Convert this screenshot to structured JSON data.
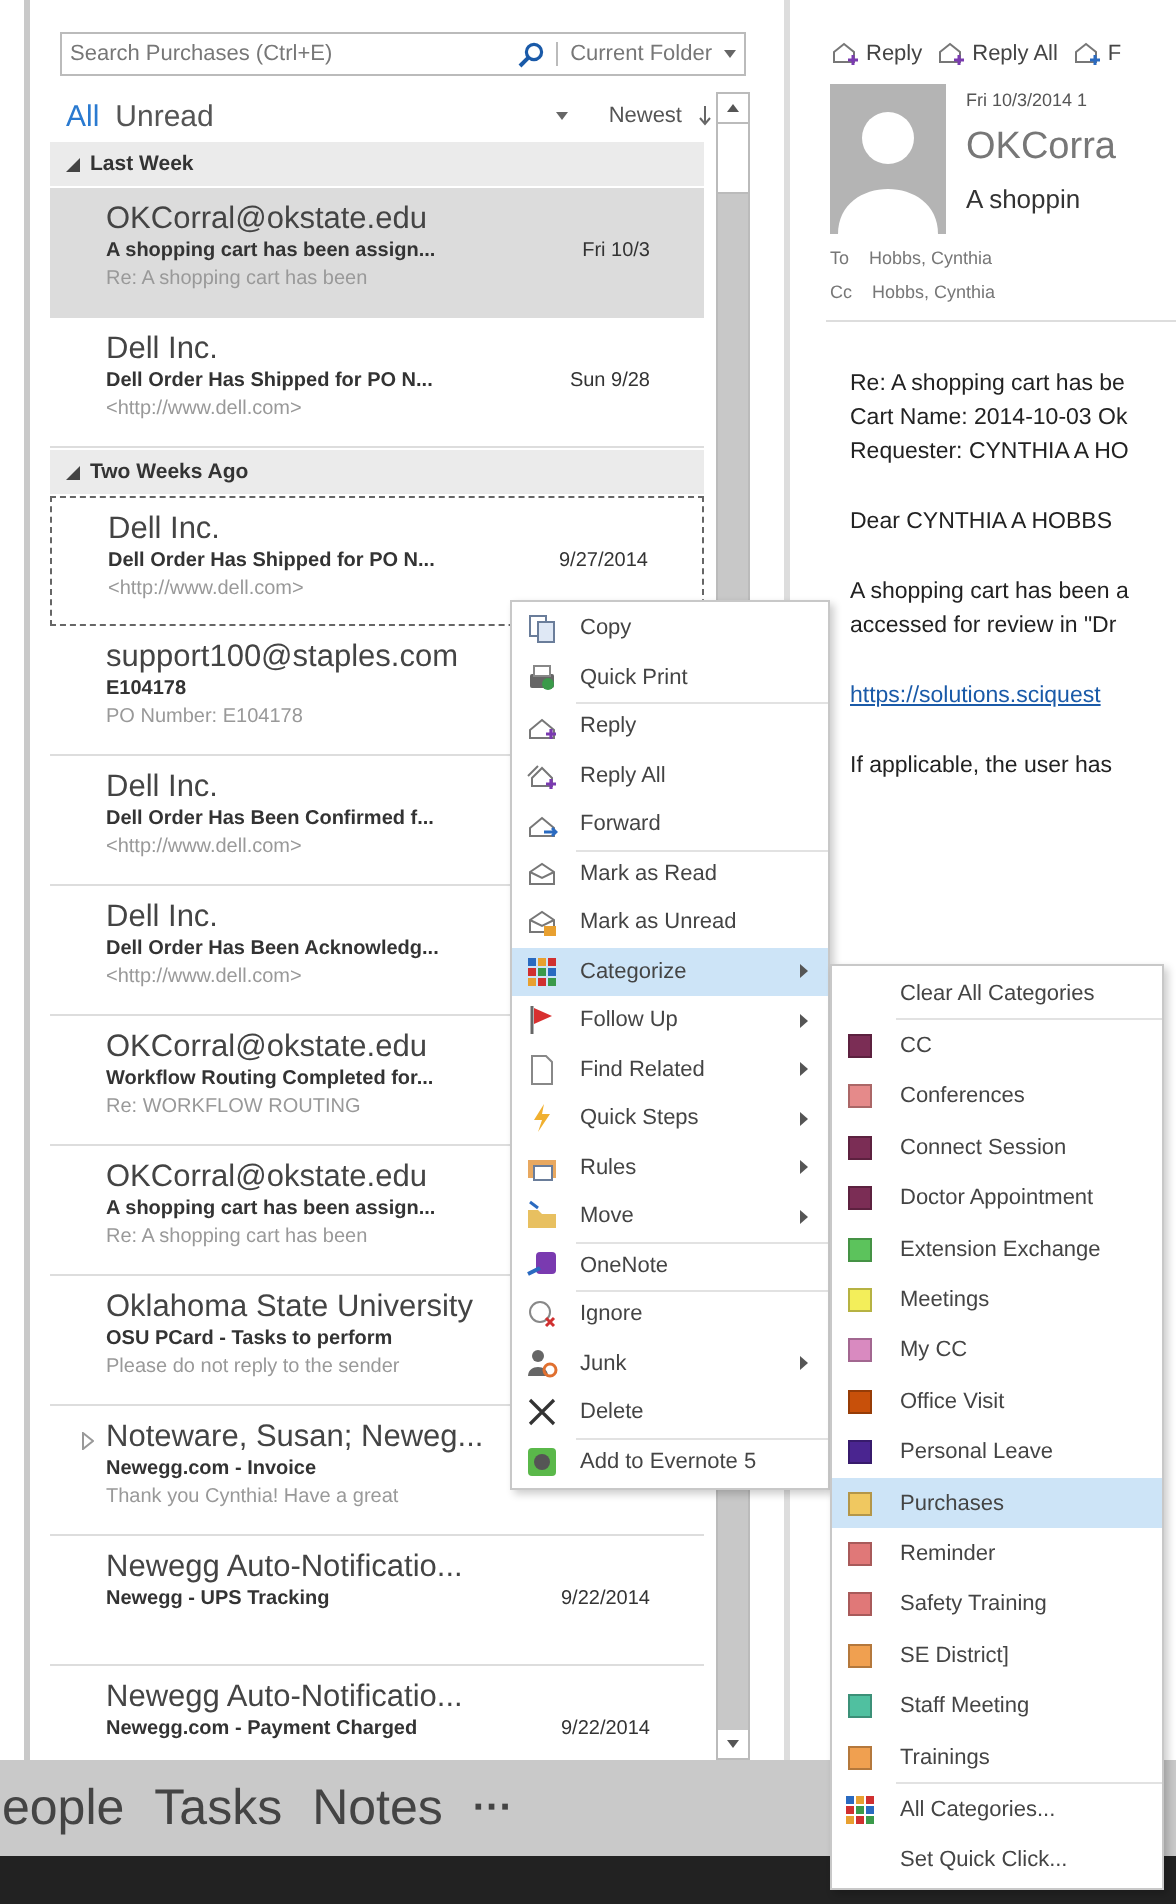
{
  "search": {
    "placeholder": "Search Purchases (Ctrl+E)",
    "scope": "Current Folder"
  },
  "filters": [
    {
      "label": "All",
      "selected": true
    },
    {
      "label": "Unread",
      "selected": false
    }
  ],
  "sort": {
    "label": "Newest"
  },
  "groups": [
    {
      "title": "Last Week",
      "expanded": true,
      "messages": [
        {
          "sender": "OKCorral@okstate.edu",
          "subject": "A shopping cart has been assign...",
          "preview": "Re: A shopping cart has been",
          "date": "Fri 10/3",
          "selected": true,
          "focused": false,
          "thread": false
        },
        {
          "sender": "Dell Inc.",
          "subject": "Dell Order Has Shipped for PO N...",
          "preview": "<http://www.dell.com>",
          "date": "Sun 9/28",
          "selected": false,
          "focused": false,
          "thread": false
        }
      ]
    },
    {
      "title": "Two Weeks Ago",
      "expanded": true,
      "messages": [
        {
          "sender": "Dell Inc.",
          "subject": "Dell Order Has Shipped for PO N...",
          "preview": "<http://www.dell.com>",
          "date": "9/27/2014",
          "selected": false,
          "focused": true,
          "thread": false
        },
        {
          "sender": "support100@staples.com",
          "subject": "E104178",
          "preview": "PO Number:   E104178",
          "selected": false,
          "focused": false,
          "thread": false
        },
        {
          "sender": "Dell Inc.",
          "subject": "Dell Order Has Been Confirmed  f...",
          "preview": "<http://www.dell.com>",
          "selected": false,
          "focused": false,
          "thread": false
        },
        {
          "sender": "Dell Inc.",
          "subject": "Dell Order Has Been Acknowledg...",
          "preview": "<http://www.dell.com>",
          "selected": false,
          "focused": false,
          "thread": false
        },
        {
          "sender": "OKCorral@okstate.edu",
          "subject": "Workflow Routing Completed for...",
          "preview": "Re: WORKFLOW ROUTING",
          "selected": false,
          "focused": false,
          "thread": false
        },
        {
          "sender": "OKCorral@okstate.edu",
          "subject": "A shopping cart has been assign...",
          "preview": "Re: A shopping cart has been",
          "selected": false,
          "focused": false,
          "thread": false
        },
        {
          "sender": "Oklahoma State University",
          "subject": "OSU PCard -  Tasks to perform",
          "preview": "Please do not reply to the sender",
          "selected": false,
          "focused": false,
          "thread": false
        },
        {
          "sender": "Noteware, Susan;  Neweg...",
          "subject": "Newegg.com - Invoice",
          "preview": "Thank you Cynthia! Have a great",
          "selected": false,
          "focused": false,
          "thread": true
        },
        {
          "sender": "Newegg Auto-Notificatio...",
          "subject": "Newegg - UPS Tracking",
          "date": "9/22/2014",
          "selected": false,
          "focused": false,
          "thread": false
        },
        {
          "sender": "Newegg Auto-Notificatio...",
          "subject": "Newegg.com - Payment  Charged",
          "date": "9/22/2014",
          "selected": false,
          "focused": false,
          "thread": false
        }
      ]
    }
  ],
  "reading": {
    "toolbar": [
      "Reply",
      "Reply All",
      "F"
    ],
    "date": "Fri 10/3/2014 1",
    "sender": "OKCorra",
    "subject": "A shoppin",
    "recipients": [
      {
        "label": "To",
        "value": "Hobbs, Cynthia"
      },
      {
        "label": "Cc",
        "value": "Hobbs, Cynthia"
      }
    ],
    "body": [
      {
        "kind": "text",
        "lines": [
          "Re: A shopping cart has be",
          "Cart Name: 2014-10-03 Ok",
          "Requester: CYNTHIA A HO"
        ]
      },
      {
        "kind": "text",
        "lines": [
          "Dear CYNTHIA A HOBBS"
        ]
      },
      {
        "kind": "text",
        "lines": [
          "A shopping cart has been a",
          "accessed for review in \"Dr"
        ]
      },
      {
        "kind": "link",
        "lines": [
          "https://solutions.sciquest"
        ]
      },
      {
        "kind": "text",
        "lines": [
          "If applicable, the user has"
        ]
      }
    ]
  },
  "menu": {
    "items": [
      {
        "label": "Copy",
        "submenu": false,
        "selected": false,
        "divider_above": false
      },
      {
        "label": "Quick Print",
        "submenu": false,
        "selected": false,
        "divider_above": false
      },
      {
        "label": "Reply",
        "submenu": false,
        "selected": false,
        "divider_above": true
      },
      {
        "label": "Reply All",
        "submenu": false,
        "selected": false,
        "divider_above": false
      },
      {
        "label": "Forward",
        "submenu": false,
        "selected": false,
        "divider_above": false
      },
      {
        "label": "Mark as Read",
        "submenu": false,
        "selected": false,
        "divider_above": true
      },
      {
        "label": "Mark as Unread",
        "submenu": false,
        "selected": false,
        "divider_above": false
      },
      {
        "label": "Categorize",
        "submenu": true,
        "selected": true,
        "divider_above": false
      },
      {
        "label": "Follow Up",
        "submenu": true,
        "selected": false,
        "divider_above": false
      },
      {
        "label": "Find Related",
        "submenu": true,
        "selected": false,
        "divider_above": false
      },
      {
        "label": "Quick Steps",
        "submenu": true,
        "selected": false,
        "divider_above": false
      },
      {
        "label": "Rules",
        "submenu": true,
        "selected": false,
        "divider_above": false
      },
      {
        "label": "Move",
        "submenu": true,
        "selected": false,
        "divider_above": false
      },
      {
        "label": "OneNote",
        "submenu": false,
        "selected": false,
        "divider_above": true
      },
      {
        "label": "Ignore",
        "submenu": false,
        "selected": false,
        "divider_above": true
      },
      {
        "label": "Junk",
        "submenu": true,
        "selected": false,
        "divider_above": false
      },
      {
        "label": "Delete",
        "submenu": false,
        "selected": false,
        "divider_above": false
      },
      {
        "label": "Add to Evernote 5",
        "submenu": false,
        "selected": false,
        "divider_above": true
      }
    ]
  },
  "categories": {
    "clear": "Clear All Categories",
    "items": [
      {
        "label": "CC",
        "color": "#7b2d55",
        "selected": false
      },
      {
        "label": "Conferences",
        "color": "#e58a8a",
        "selected": false
      },
      {
        "label": "Connect Session",
        "color": "#7b2d55",
        "selected": false
      },
      {
        "label": "Doctor Appointment",
        "color": "#7b2d55",
        "selected": false
      },
      {
        "label": "Extension Exchange",
        "color": "#5cc35c",
        "selected": false
      },
      {
        "label": "Meetings",
        "color": "#f3ee5a",
        "selected": false
      },
      {
        "label": "My CC",
        "color": "#d98ac0",
        "selected": false
      },
      {
        "label": "Office Visit",
        "color": "#c8500a",
        "selected": false
      },
      {
        "label": "Personal Leave",
        "color": "#4a2590",
        "selected": false
      },
      {
        "label": "Purchases",
        "color": "#f0c860",
        "selected": true
      },
      {
        "label": "Reminder",
        "color": "#e07878",
        "selected": false
      },
      {
        "label": "Safety Training",
        "color": "#e07878",
        "selected": false
      },
      {
        "label": "SE District]",
        "color": "#f0a050",
        "selected": false
      },
      {
        "label": "Staff Meeting",
        "color": "#50c0a0",
        "selected": false
      },
      {
        "label": "Trainings",
        "color": "#f0a050",
        "selected": false
      }
    ],
    "footer": [
      {
        "label": "All Categories...",
        "kind": "all"
      },
      {
        "label": "Set Quick Click...",
        "kind": "plain"
      }
    ]
  },
  "nav": {
    "items": [
      "eople",
      "Tasks",
      "Notes"
    ],
    "more": "···"
  }
}
